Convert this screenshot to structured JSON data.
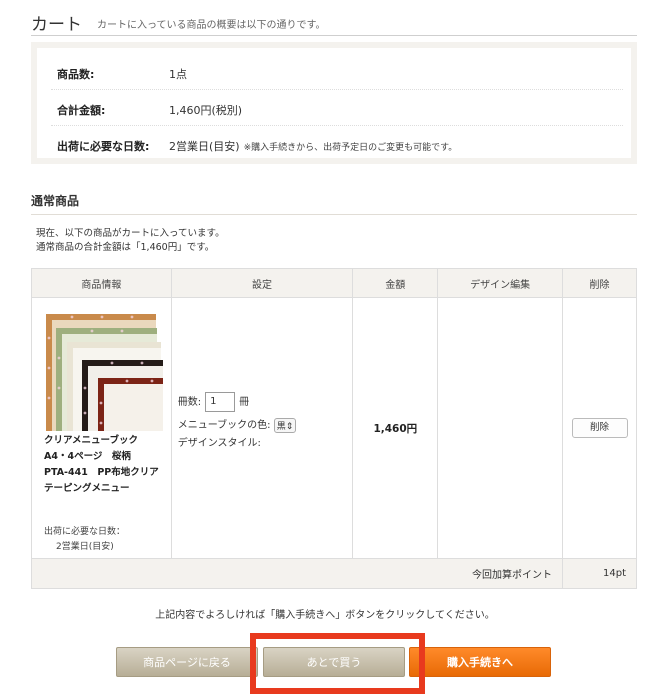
{
  "header": {
    "title": "カート",
    "subtitle": "カートに入っている商品の概要は以下の通りです。"
  },
  "summary": {
    "rows": [
      {
        "label": "商品数:",
        "value": "1点",
        "note": ""
      },
      {
        "label": "合計金額:",
        "value": "1,460円(税別)",
        "note": ""
      },
      {
        "label": "出荷に必要な日数:",
        "value": "2営業日(目安)",
        "note": "※購入手続きから、出荷予定日のご変更も可能です。"
      }
    ]
  },
  "section": {
    "title": "通常商品",
    "desc_line1": "現在、以下の商品がカートに入っています。",
    "desc_line2": "通常商品の合計金額は「1,460円」です。"
  },
  "table": {
    "headers": {
      "info": "商品情報",
      "settings": "設定",
      "price": "金額",
      "design": "デザイン編集",
      "delete": "削除"
    },
    "item": {
      "name": "クリアメニューブック　A4・4ページ　桜柄　PTA-441　PP布地クリアテーピングメニュー",
      "ship_label": "出荷に必要な日数：",
      "ship_value": "2営業日(目安)",
      "qty_label": "冊数:",
      "qty_value": "1",
      "qty_unit": "冊",
      "color_label": "メニューブックの色:",
      "color_value": "黒",
      "style_label": "デザインスタイル:",
      "price": "1,460円",
      "delete_label": "削除"
    },
    "points": {
      "label": "今回加算ポイント",
      "value": "14pt"
    }
  },
  "confirm_text": "上記内容でよろしければ「購入手続きへ」ボタンをクリックしてください。",
  "buttons": {
    "back": "商品ページに戻る",
    "later": "あとで買う",
    "buy": "購入手続きへ"
  },
  "colors": {
    "panel_bg": "#f4f2ee",
    "buy_button": "#f07410",
    "secondary_button": "#c4bca7",
    "highlight": "#e83a1e"
  }
}
